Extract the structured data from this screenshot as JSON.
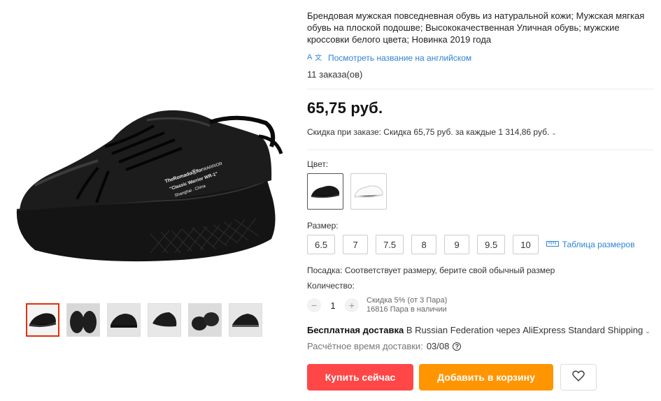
{
  "product": {
    "title": "Брендовая мужская повседневная обувь из натуральной кожи; Мужская мягкая обувь на плоской подошве; Высококачественная Уличная обувь; мужские кроссовки белого цвета; Новинка 2019 года",
    "translate_link": "Посмотреть название на английском",
    "orders": "11 заказа(ов)",
    "price": "65,75 руб.",
    "discount": "Скидка при заказе: Скидка 65,75 руб. за каждые 1 314,86 руб."
  },
  "color": {
    "label": "Цвет:",
    "options": [
      {
        "name": "black",
        "selected": true
      },
      {
        "name": "white",
        "selected": false
      }
    ]
  },
  "size": {
    "label": "Размер:",
    "options": [
      "6.5",
      "7",
      "7.5",
      "8",
      "9",
      "9.5",
      "10"
    ],
    "table_link": "Таблица размеров"
  },
  "fit": "Посадка: Соответствует размеру, берите свой обычный размер",
  "quantity": {
    "label": "Количество:",
    "minus": "−",
    "value": "1",
    "plus": "+",
    "discount_note": "Скидка 5% (от 3 Пара)",
    "stock": "16816 Пара в наличии"
  },
  "shipping": {
    "free": "Бесплатная доставка",
    "details": "В Russian Federation через AliExpress Standard Shipping",
    "eta_label": "Расчётное время доставки:",
    "eta_date": "03/08"
  },
  "buttons": {
    "buy": "Купить сейчас",
    "cart": "Добавить в корзину"
  },
  "shoe_print": {
    "line1": "TheRomadoⓇfor",
    "line1b": "WARRIOR",
    "line2": "\"Classic Warrior WR-1\"",
    "line3": "Shanghai . China"
  },
  "colors": {
    "accent_red": "#ff4747",
    "accent_orange": "#ff9500",
    "link_blue": "#2e83d6",
    "thumb_active": "#e62e04"
  },
  "icons": {
    "translate": "translate-icon",
    "ruler": "ruler-icon",
    "help": "question-icon",
    "wishlist": "heart-icon"
  }
}
